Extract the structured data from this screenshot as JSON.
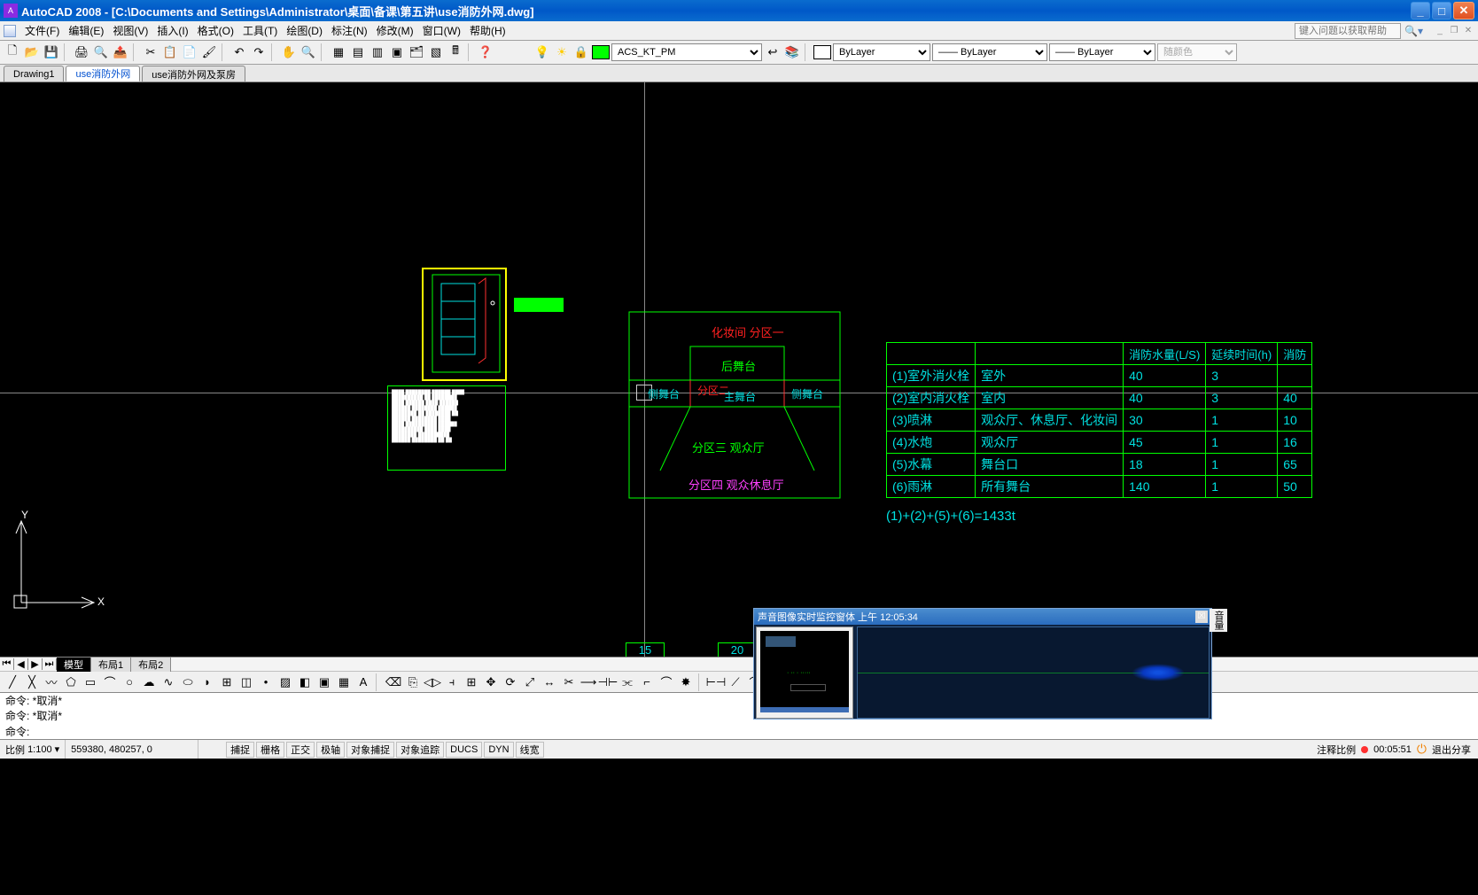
{
  "title_bar": {
    "app": "AutoCAD 2008",
    "doc_path": "[C:\\Documents and Settings\\Administrator\\桌面\\备课\\第五讲\\use消防外网.dwg]"
  },
  "menus": [
    "文件(F)",
    "编辑(E)",
    "视图(V)",
    "插入(I)",
    "格式(O)",
    "工具(T)",
    "绘图(D)",
    "标注(N)",
    "修改(M)",
    "窗口(W)",
    "帮助(H)"
  ],
  "help_placeholder": "键入问题以获取帮助",
  "layer_combo": "ACS_KT_PM",
  "prop_layer": "ByLayer",
  "prop_ltype": "ByLayer",
  "prop_lw": "ByLayer",
  "prop_color": "随颜色",
  "drawing_tabs": [
    "Drawing1",
    "use消防外网",
    "use消防外网及泵房"
  ],
  "drawing_tab_active": 1,
  "canvas": {
    "zone_labels": {
      "top_red": "化妆间  分区一",
      "back_stage": "后舞台",
      "zone2_left": "分区二",
      "main_stage": "主舞台",
      "side_stage": "侧舞台",
      "side_left": "侧舞台",
      "zone3": "分区三  观众厅",
      "zone4": "分区四  观众休息厅"
    },
    "table": {
      "headers": [
        "",
        "",
        "消防水量(L/S)",
        "延续时间(h)",
        "消防"
      ],
      "rows": [
        {
          "idx": "(1)",
          "name": "室外消火栓",
          "scope": "室外",
          "flow": "40",
          "dur": "3",
          "ext": ""
        },
        {
          "idx": "(2)",
          "name": "室内消火栓",
          "scope": "室内",
          "flow": "40",
          "dur": "3",
          "ext": "40"
        },
        {
          "idx": "(3)",
          "name": "喷淋",
          "scope": "观众厅、休息厅、化妆间",
          "flow": "30",
          "dur": "1",
          "ext": "10"
        },
        {
          "idx": "(4)",
          "name": "水炮",
          "scope": "观众厅",
          "flow": "45",
          "dur": "1",
          "ext": "16"
        },
        {
          "idx": "(5)",
          "name": "水幕",
          "scope": "舞台口",
          "flow": "18",
          "dur": "1",
          "ext": "65"
        },
        {
          "idx": "(6)",
          "name": "雨淋",
          "scope": "所有舞台",
          "flow": "140",
          "dur": "1",
          "ext": "50"
        }
      ],
      "formula": "(1)+(2)+(5)+(6)=1433t"
    },
    "dim_left": "15",
    "dim_right": "20"
  },
  "layout_tabs": [
    "模型",
    "布局1",
    "布局2"
  ],
  "cmd_history": [
    "命令: *取消*",
    "命令: *取消*"
  ],
  "cmd_prompt": "命令:",
  "status": {
    "scale_label": "比例",
    "scale_value": "1:100",
    "coords": "559380, 480257, 0",
    "toggles": [
      "捕捉",
      "栅格",
      "正交",
      "极轴",
      "对象捕捉",
      "对象追踪",
      "DUCS",
      "DYN",
      "线宽"
    ],
    "annoscale": "注释比例",
    "timer": "00:05:51",
    "exit": "退出分享"
  },
  "floating": {
    "title": "声音图像实时监控窗体 上午 12:05:34",
    "vol_label": "音量"
  },
  "ucs_labels": {
    "x": "X",
    "y": "Y"
  }
}
